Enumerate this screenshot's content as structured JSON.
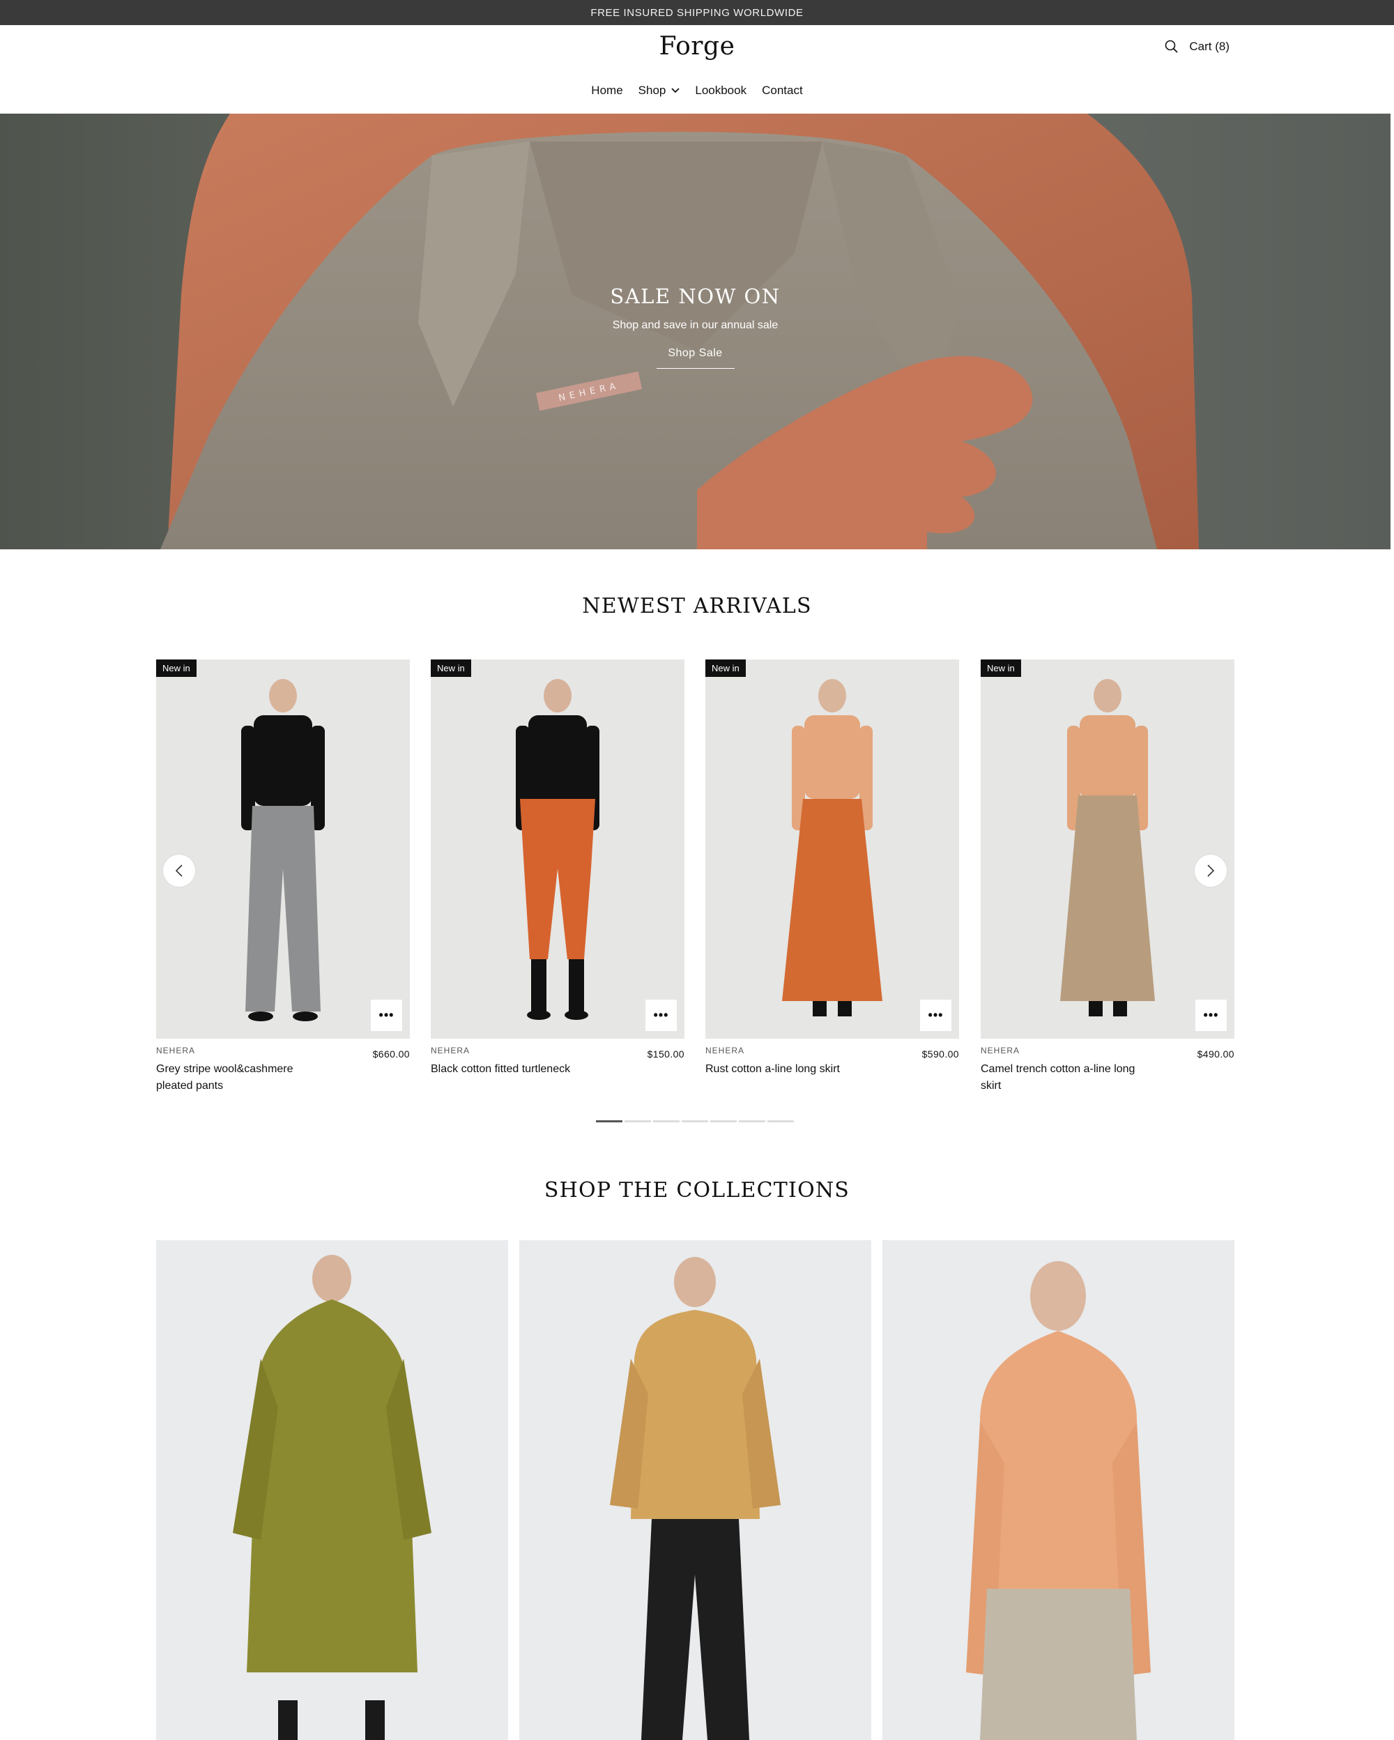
{
  "announcement": "FREE INSURED SHIPPING WORLDWIDE",
  "header": {
    "logo": "Forge",
    "cart_label": "Cart (8)",
    "search_icon": "search-icon"
  },
  "nav": [
    {
      "label": "Home"
    },
    {
      "label": "Shop",
      "has_dropdown": true
    },
    {
      "label": "Lookbook"
    },
    {
      "label": "Contact"
    }
  ],
  "hero": {
    "title": "SALE NOW ON",
    "subtitle": "Shop and save in our annual sale",
    "button": "Shop Sale",
    "label_text": "NEHERA"
  },
  "arrivals": {
    "title": "NEWEST ARRIVALS",
    "products": [
      {
        "badge": "New in",
        "vendor": "NEHERA",
        "name": "Grey stripe wool&cashmere pleated pants",
        "price": "$660.00"
      },
      {
        "badge": "New in",
        "vendor": "NEHERA",
        "name": "Black cotton fitted turtleneck",
        "price": "$150.00"
      },
      {
        "badge": "New in",
        "vendor": "NEHERA",
        "name": "Rust cotton a-line long skirt",
        "price": "$590.00"
      },
      {
        "badge": "New in",
        "vendor": "NEHERA",
        "name": "Camel trench cotton a-line long skirt",
        "price": "$490.00"
      }
    ],
    "pagination_active": 1,
    "pagination_total": 7
  },
  "collections": {
    "title": "SHOP THE COLLECTIONS"
  },
  "colors": {
    "announce_bg": "#3a3a3a",
    "badge_bg": "#111111",
    "product_bg": "#e8e8e6"
  }
}
